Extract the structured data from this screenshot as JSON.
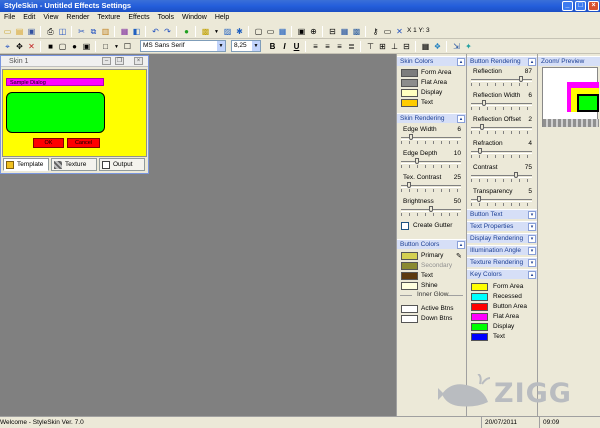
{
  "window": {
    "title": "StyleSkin - Untitled Effects Settings"
  },
  "menu": [
    "File",
    "Edit",
    "View",
    "Render",
    "Texture",
    "Effects",
    "Tools",
    "Window",
    "Help"
  ],
  "toolbar": {
    "coordinates": "X 1 Y: 3",
    "font_name": "MS Sans Serif",
    "font_size": "8,25",
    "bold": "B",
    "italic": "I",
    "underline": "U"
  },
  "skin_window": {
    "title": "Skin 1",
    "dialog_title": "Sample Dialog",
    "ok_label": "OK",
    "cancel_label": "Cancel",
    "tabs": [
      "Template",
      "Texture",
      "Output"
    ]
  },
  "skin_colors": {
    "header": "Skin Colors",
    "items": [
      {
        "label": "Form Area",
        "color": "#7d7d7d"
      },
      {
        "label": "Flat Area",
        "color": "#8c8c8c"
      },
      {
        "label": "Display",
        "color": "#ffffc0"
      },
      {
        "label": "Text",
        "color": "#ffcc00"
      }
    ]
  },
  "skin_rendering": {
    "header": "Skin Rendering",
    "sliders": [
      {
        "label": "Edge Width",
        "value": "6",
        "pos": 0.15
      },
      {
        "label": "Edge Depth",
        "value": "10",
        "pos": 0.25
      },
      {
        "label": "Tex. Contrast",
        "value": "25",
        "pos": 0.1
      },
      {
        "label": "Brightness",
        "value": "50",
        "pos": 0.5
      }
    ],
    "checkbox_label": "Create Gutter"
  },
  "button_colors": {
    "header": "Button Colors",
    "items": [
      {
        "label": "Primary",
        "color": "#d4d050"
      },
      {
        "label": "Secondary",
        "color": "#8a8a30",
        "disabled": true
      },
      {
        "label": "Text",
        "color": "#5c3a10"
      },
      {
        "label": "Shine",
        "color": "#ffffe0"
      }
    ],
    "inner_glow_label": "Inner Glow",
    "glow_items": [
      {
        "label": "Active Btns",
        "color": "#ffffff"
      },
      {
        "label": "Down Btns",
        "color": "#ffffff"
      }
    ]
  },
  "button_rendering": {
    "header": "Button Rendering",
    "sliders": [
      {
        "label": "Reflection",
        "value": "87",
        "pos": 0.85
      },
      {
        "label": "Reflection Width",
        "value": "6",
        "pos": 0.2
      },
      {
        "label": "Reflection Offset",
        "value": "2",
        "pos": 0.15
      },
      {
        "label": "Refraction",
        "value": "4",
        "pos": 0.12
      },
      {
        "label": "Contrast",
        "value": "75",
        "pos": 0.75
      },
      {
        "label": "Transparency",
        "value": "5",
        "pos": 0.1
      }
    ]
  },
  "collapsed_panels": [
    "Button Text",
    "Text Properties",
    "Display Rendering",
    "Illumination Angle",
    "Texture Rendering"
  ],
  "key_colors": {
    "header": "Key Colors",
    "items": [
      {
        "label": "Form Area",
        "color": "#ffff00"
      },
      {
        "label": "Recessed",
        "color": "#00ffff"
      },
      {
        "label": "Button Area",
        "color": "#ff0000"
      },
      {
        "label": "Flat Area",
        "color": "#ff00ff"
      },
      {
        "label": "Display",
        "color": "#00ff00"
      },
      {
        "label": "Text",
        "color": "#0000ff"
      }
    ]
  },
  "zoom_preview": {
    "header": "Zoom/ Preview"
  },
  "status": {
    "left": "Welcome - StyleSkin Ver. 7.0",
    "date": "20/07/2011",
    "time": "09:09"
  },
  "watermark": "ZIGG"
}
